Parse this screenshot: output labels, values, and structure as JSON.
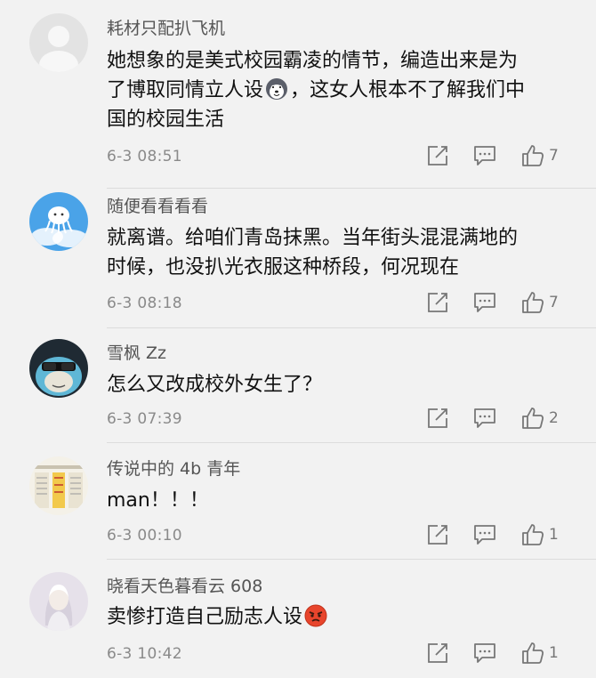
{
  "comments": [
    {
      "username": "耗材只配扒飞机",
      "lines": [
        "她想象的是美式校园霸凌的情节，编造出来是为",
        "了博取同情立人设",
        "，这女人根本不了解我们中",
        "国的校园生活"
      ],
      "timestamp": "6-3 08:51",
      "likes": "7",
      "avatar": "default-avatar"
    },
    {
      "username": "随便看看看看",
      "lines": [
        "就离谱。给咱们青岛抹黑。当年街头混混满地的",
        "时候，也没扒光衣服这种桥段，何况现在"
      ],
      "timestamp": "6-3 08:18",
      "likes": "7",
      "avatar": "cloud-jellyfish-avatar"
    },
    {
      "username": "雪枫 Zz",
      "lines": [
        "怎么又改成校外女生了？"
      ],
      "timestamp": "6-3 07:39",
      "likes": "2",
      "avatar": "sunglasses-character-avatar"
    },
    {
      "username": "传说中的 4b 青年",
      "lines": [
        "man！！！"
      ],
      "timestamp": "6-3 00:10",
      "likes": "1",
      "avatar": "newspaper-avatar"
    },
    {
      "username": "晓看天色暮看云 608",
      "lines": [
        "卖惨打造自己励志人设"
      ],
      "timestamp": "6-3 10:42",
      "likes": "1",
      "avatar": "illustrated-girl-avatar"
    }
  ],
  "icons": {
    "share": "share-icon",
    "reply": "comment-icon",
    "like": "thumbs-up-icon",
    "emoji_husky": "husky-emoji-icon",
    "emoji_angry": "angry-emoji-icon"
  },
  "colors": {
    "background": "#f2f2f2",
    "username": "#555555",
    "body_text": "#111111",
    "meta_text": "#8a8a8a"
  }
}
